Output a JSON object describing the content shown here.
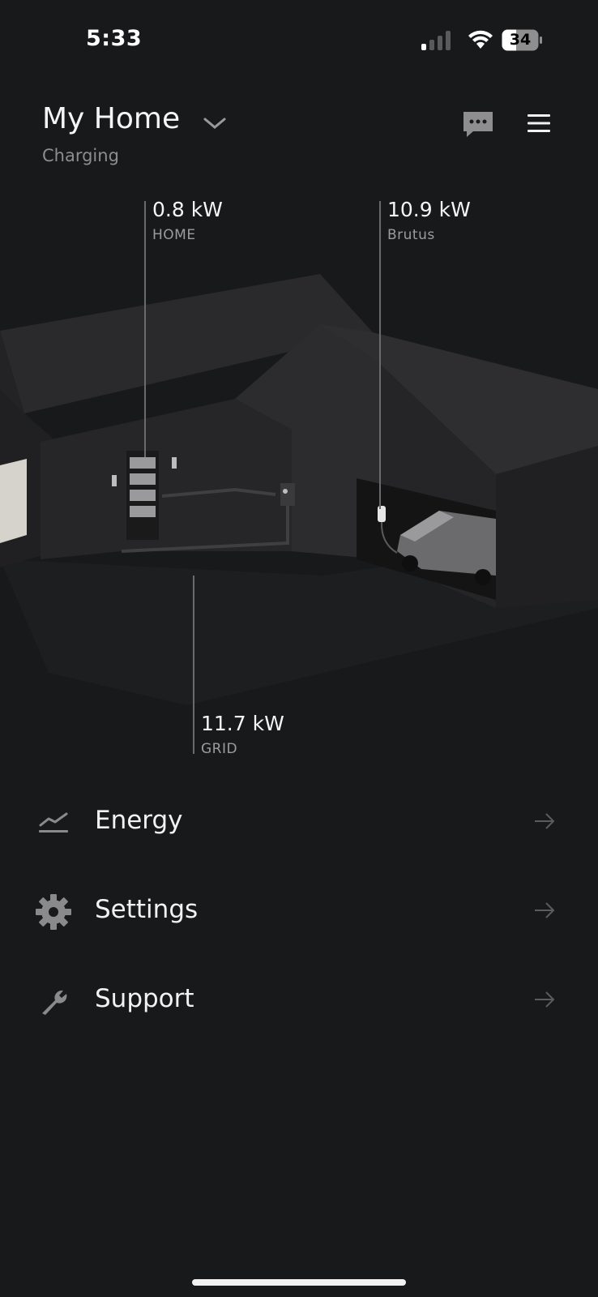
{
  "status_bar": {
    "time": "5:33",
    "battery": "34",
    "icons": [
      "signal-icon",
      "wifi-icon",
      "battery-icon"
    ]
  },
  "header": {
    "title": "My Home",
    "subtitle": "Charging",
    "icons": [
      "chevron-down-icon",
      "chat-icon",
      "hamburger-menu-icon"
    ]
  },
  "flows": {
    "home": {
      "value": "0.8 kW",
      "label": "HOME"
    },
    "vehicle": {
      "value": "10.9 kW",
      "label": "Brutus"
    },
    "grid": {
      "value": "11.7 kW",
      "label": "GRID"
    }
  },
  "menu": [
    {
      "label": "Energy",
      "icon": "chart-line-icon"
    },
    {
      "label": "Settings",
      "icon": "gear-icon"
    },
    {
      "label": "Support",
      "icon": "wrench-icon"
    }
  ],
  "colors": {
    "background": "#18191b",
    "text": "#f2f2f2",
    "muted": "#8d8d8f"
  }
}
